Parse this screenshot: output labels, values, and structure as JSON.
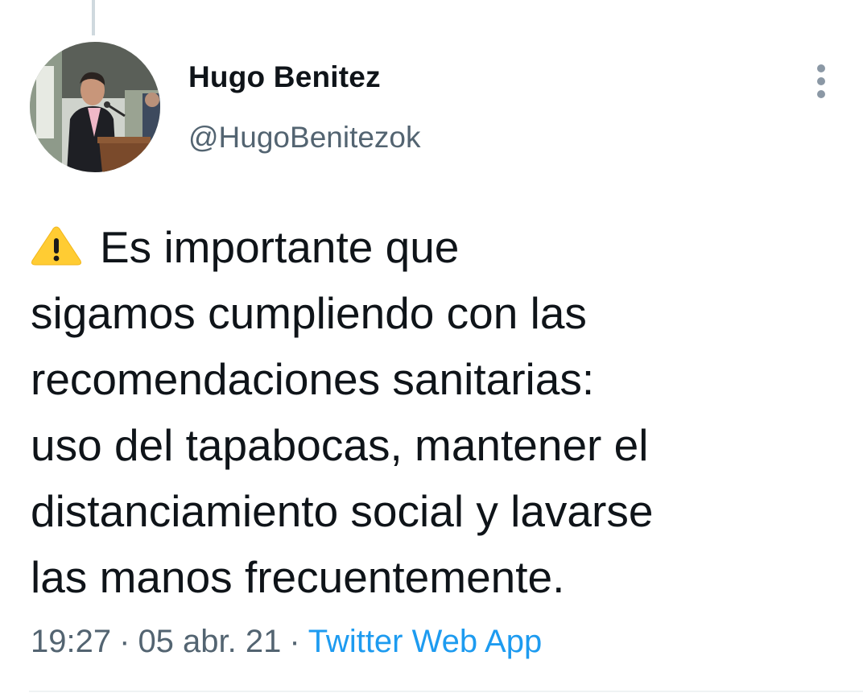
{
  "tweet": {
    "author": {
      "display_name": "Hugo Benitez",
      "handle": "@HugoBenitezok"
    },
    "text_lines": [
      "Es importante que",
      "sigamos cumpliendo con las",
      "recomendaciones sanitarias:",
      "uso del tapabocas, mantener el",
      "distanciamiento social y lavarse",
      "las manos frecuentemente."
    ],
    "leading_icon": "warning-sign-icon",
    "time": "19:27",
    "date": "05 abr. 21",
    "separator": "·",
    "source": "Twitter Web App"
  },
  "colors": {
    "text": "#0f1419",
    "secondary": "#536471",
    "link": "#1d9bf0",
    "warning_yellow": "#ffcc33"
  },
  "icons": {
    "more": "more-vertical-icon",
    "warning": "warning-sign-icon"
  }
}
